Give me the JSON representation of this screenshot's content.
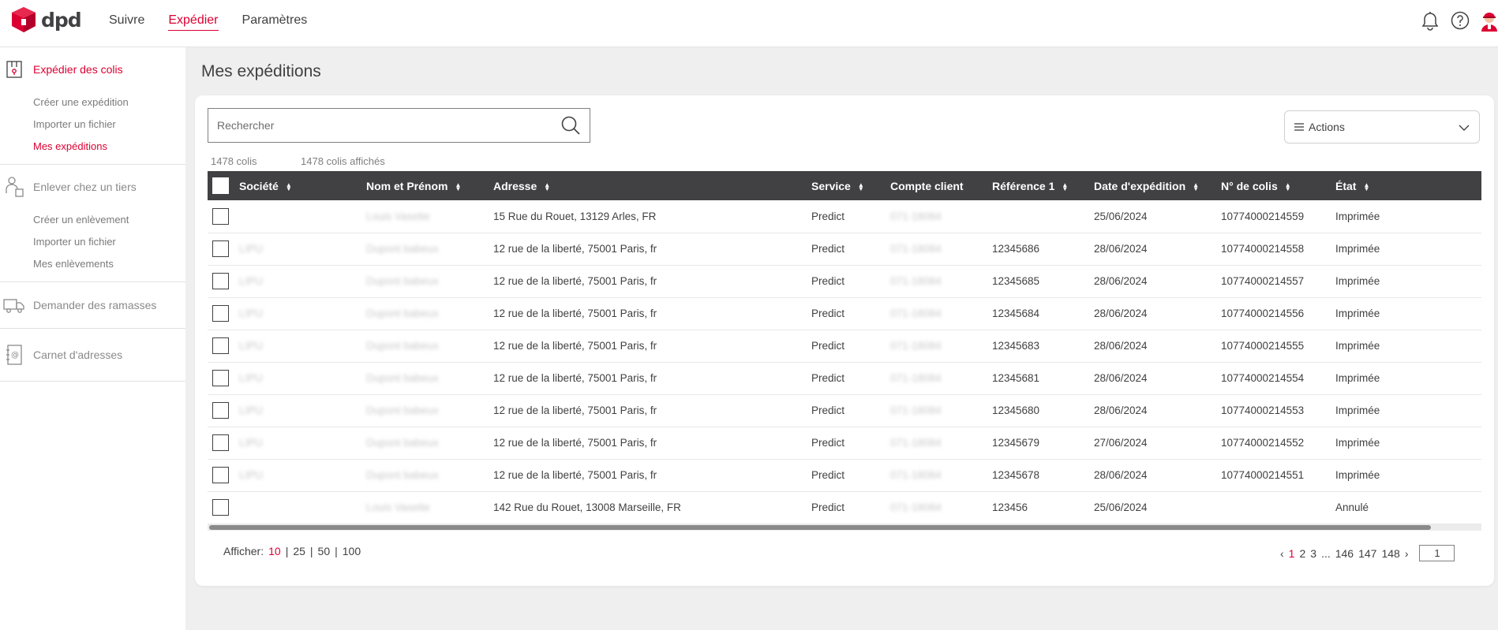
{
  "brand": {
    "name": "dpd",
    "accent": "#dc0032",
    "dark": "#414042"
  },
  "topnav": [
    {
      "label": "Suivre"
    },
    {
      "label": "Expédier"
    },
    {
      "label": "Paramètres"
    }
  ],
  "icons": {
    "notifications": "bell-icon",
    "help": "help-icon",
    "user": "avatar"
  },
  "sidebar": {
    "sections": [
      {
        "label": "Expédier des colis",
        "icon": "parcel-icon",
        "items": [
          "Créer une expédition",
          "Importer un fichier",
          "Mes expéditions"
        ]
      },
      {
        "label": "Enlever chez un tiers",
        "icon": "person-pickup-icon",
        "items": [
          "Créer un enlèvement",
          "Importer un fichier",
          "Mes enlèvements"
        ]
      },
      {
        "label": "Demander des ramasses",
        "icon": "truck-icon",
        "items": []
      },
      {
        "label": "Carnet d'adresses",
        "icon": "address-book-icon",
        "items": []
      }
    ]
  },
  "page": {
    "title": "Mes expéditions"
  },
  "search": {
    "placeholder": "Rechercher"
  },
  "actions": {
    "label": "Actions"
  },
  "counts": {
    "total": "1478 colis",
    "shown": "1478 colis affichés"
  },
  "table": {
    "columns": [
      "Société",
      "Nom et Prénom",
      "Adresse",
      "Service",
      "Compte client",
      "Référence 1",
      "Date d'expédition",
      "N° de colis",
      "État"
    ],
    "rows": [
      [
        "",
        "Louis Vasette",
        "15 Rue du Rouet, 13129 Arles, FR",
        "Predict",
        "071-18084",
        "",
        "25/06/2024",
        "10774000214559",
        "Imprimée"
      ],
      [
        "LIPU",
        "Dupont babeux",
        "12 rue de la liberté, 75001 Paris, fr",
        "Predict",
        "071-18084",
        "12345686",
        "28/06/2024",
        "10774000214558",
        "Imprimée"
      ],
      [
        "LIPU",
        "Dupont babeux",
        "12 rue de la liberté, 75001 Paris, fr",
        "Predict",
        "071-18084",
        "12345685",
        "28/06/2024",
        "10774000214557",
        "Imprimée"
      ],
      [
        "LIPU",
        "Dupont babeux",
        "12 rue de la liberté, 75001 Paris, fr",
        "Predict",
        "071-18084",
        "12345684",
        "28/06/2024",
        "10774000214556",
        "Imprimée"
      ],
      [
        "LIPU",
        "Dupont babeux",
        "12 rue de la liberté, 75001 Paris, fr",
        "Predict",
        "071-18084",
        "12345683",
        "28/06/2024",
        "10774000214555",
        "Imprimée"
      ],
      [
        "LIPU",
        "Dupont babeux",
        "12 rue de la liberté, 75001 Paris, fr",
        "Predict",
        "071-18084",
        "12345681",
        "28/06/2024",
        "10774000214554",
        "Imprimée"
      ],
      [
        "LIPU",
        "Dupont babeux",
        "12 rue de la liberté, 75001 Paris, fr",
        "Predict",
        "071-18084",
        "12345680",
        "28/06/2024",
        "10774000214553",
        "Imprimée"
      ],
      [
        "LIPU",
        "Dupont babeux",
        "12 rue de la liberté, 75001 Paris, fr",
        "Predict",
        "071-18084",
        "12345679",
        "27/06/2024",
        "10774000214552",
        "Imprimée"
      ],
      [
        "LIPU",
        "Dupont babeux",
        "12 rue de la liberté, 75001 Paris, fr",
        "Predict",
        "071-18084",
        "12345678",
        "28/06/2024",
        "10774000214551",
        "Imprimée"
      ],
      [
        "",
        "Louis Vasette",
        "142 Rue du Rouet, 13008 Marseille, FR",
        "Predict",
        "071-18084",
        "123456",
        "25/06/2024",
        "",
        "Annulé"
      ]
    ]
  },
  "pagination": {
    "show_label": "Afficher:",
    "sizes": [
      "10",
      "25",
      "50",
      "100"
    ],
    "pages": [
      "1",
      "2",
      "3",
      "...",
      "146",
      "147",
      "148"
    ],
    "current_input": "1"
  }
}
